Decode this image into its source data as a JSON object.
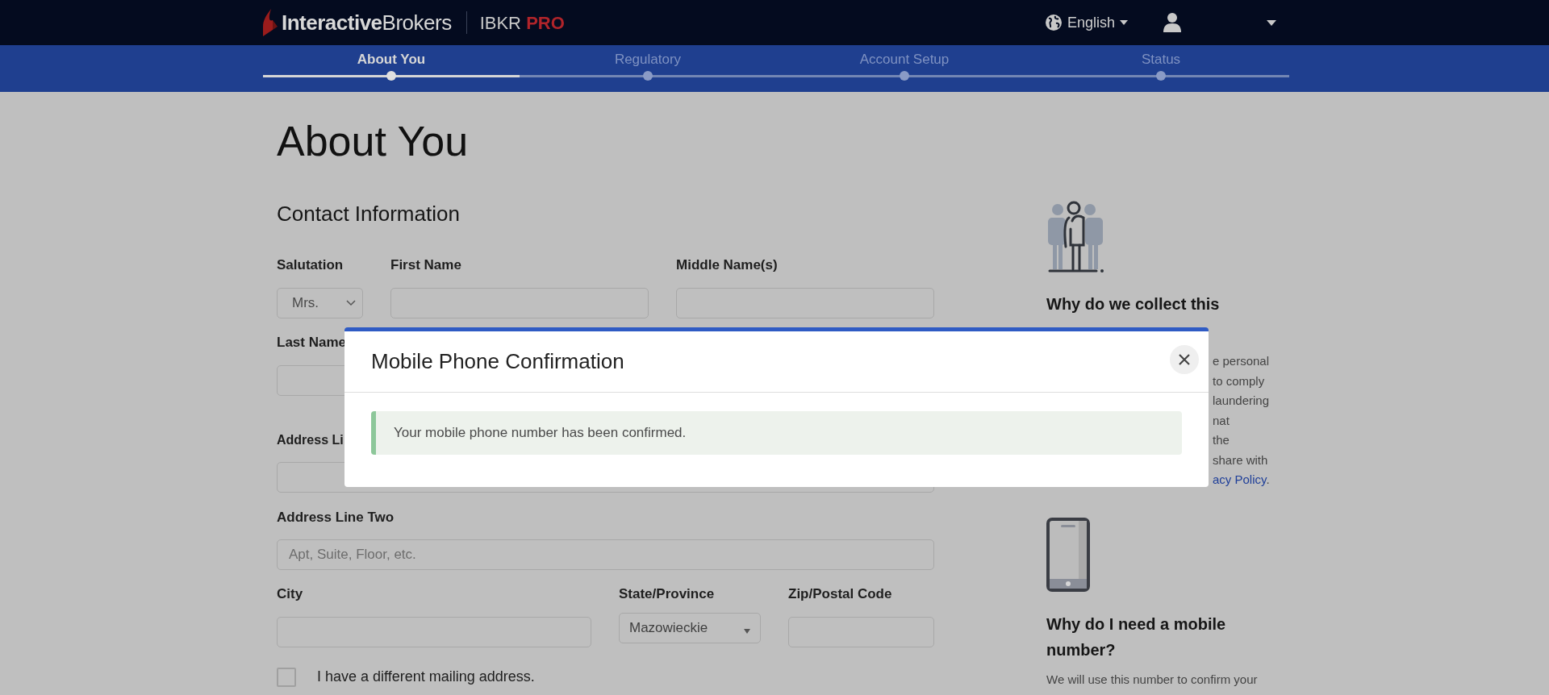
{
  "header": {
    "logo": "**Interactive**Brokers",
    "product": "IBKR",
    "product_suffix": "PRO",
    "language": "English"
  },
  "steps": [
    {
      "label": "About You",
      "selected": true
    },
    {
      "label": "Regulatory",
      "selected": false
    },
    {
      "label": "Account Setup",
      "selected": false
    },
    {
      "label": "Status",
      "selected": false
    }
  ],
  "progress": {
    "level": 0.25
  },
  "page_title": "About You",
  "section_title": "Contact Information",
  "form": {
    "salutation": {
      "label": "Salutation",
      "value": "Mrs."
    },
    "first_name": {
      "label": "First Name"
    },
    "middle_name": {
      "label": "Middle Name(s)"
    },
    "last_name": {
      "label": "Last Name"
    },
    "address_line_one": {
      "label": "Address Li"
    },
    "address_line_two": {
      "label": "Address Line Two",
      "placeholder": "Apt, Suite, Floor, etc."
    },
    "city": {
      "label": "City"
    },
    "state": {
      "label": "State/Province",
      "value": "Mazowieckie"
    },
    "zip": {
      "label": "Zip/Postal Code"
    },
    "mailing": {
      "label": "I have a different mailing address.",
      "checked": false
    }
  },
  "sidebar": {
    "collect_heading": "Why do we collect this",
    "collect_lines": [
      "e personal",
      "to comply",
      "laundering",
      "nat",
      "the",
      "share with"
    ],
    "privacy_link": "acy Policy",
    "privacy_after": ".",
    "mobile_heading": "Why do I need a mobile number?",
    "mobile_text": "We will use this number to confirm your"
  },
  "modal": {
    "title": "Mobile Phone Confirmation",
    "message": "Your mobile phone number has been confirmed."
  }
}
